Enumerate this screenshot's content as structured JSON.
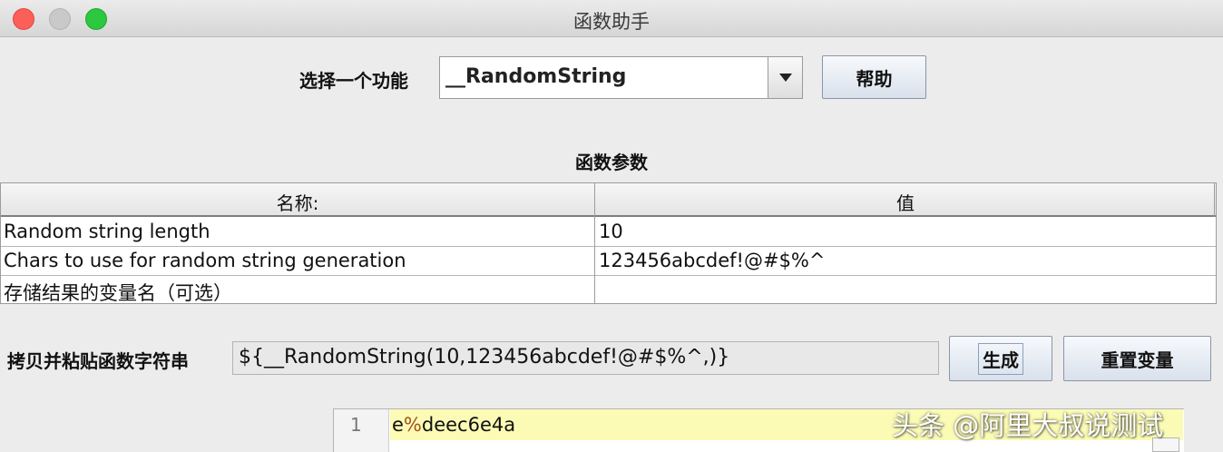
{
  "window": {
    "title": "函数助手"
  },
  "selector": {
    "label": "选择一个功能",
    "value": "__RandomString",
    "help_label": "帮助"
  },
  "params": {
    "title": "函数参数",
    "headers": [
      "名称:",
      "值"
    ],
    "rows": [
      {
        "name": "Random string length",
        "value": "10"
      },
      {
        "name": "Chars to use for random string generation",
        "value": "123456abcdef!@#$%^"
      },
      {
        "name": "存储结果的变量名（可选）",
        "value": ""
      }
    ]
  },
  "copy": {
    "label": "拷贝并粘贴函数字符串",
    "value": "${__RandomString(10,123456abcdef!@#$%^,)}",
    "generate_label": "生成",
    "reset_label": "重置变量"
  },
  "result": {
    "line_number": "1",
    "text_before": "e",
    "text_special": "%",
    "text_after": "deec6e4a"
  },
  "watermark": "头条 @阿里大叔说测试",
  "colors": {
    "accent_highlight": "#fbfbb5",
    "close": "#fc5f57",
    "maximize": "#2bc840"
  }
}
